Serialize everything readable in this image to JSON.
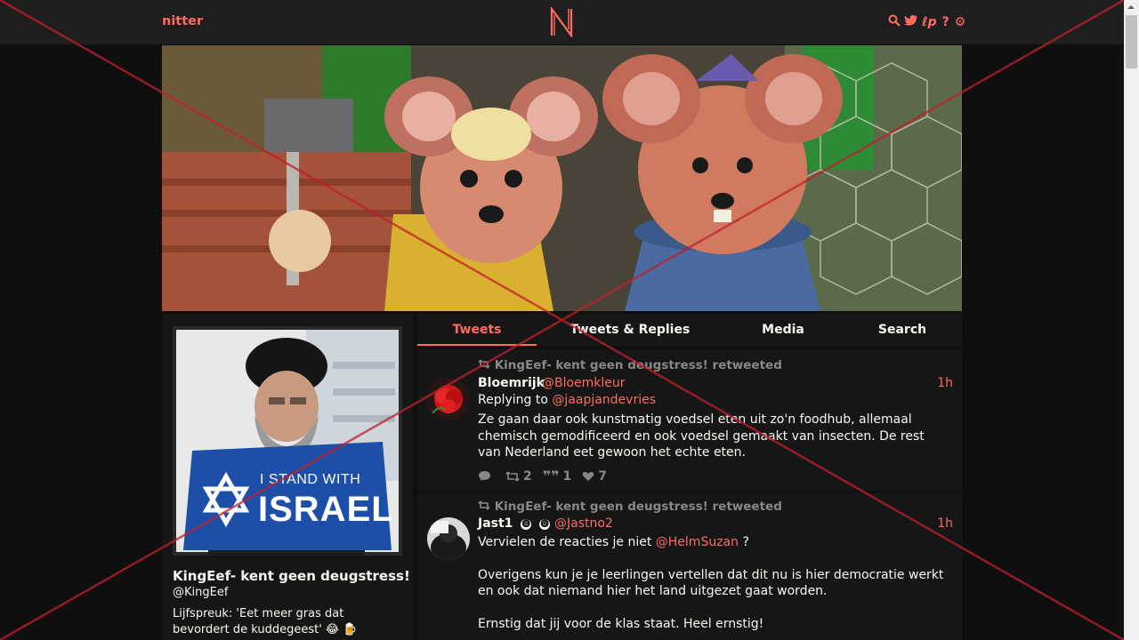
{
  "navbar": {
    "site_name": "nitter",
    "logo_letter": "N",
    "icons": [
      "search-icon",
      "bird-icon",
      "rss-icon",
      "help-icon",
      "gear-icon"
    ],
    "accent_color": "#ff6c60"
  },
  "profile": {
    "fullname": "KingEef- kent geen deugstress!",
    "username": "@KingEef",
    "bio": "Lijfspreuk: 'Eet meer gras dat bevordert de kuddegeest' 😂 🍺",
    "avatar_sign_line1": "I STAND WITH",
    "avatar_sign_line2": "ISRAEL"
  },
  "tabs": [
    {
      "label": "Tweets",
      "active": true
    },
    {
      "label": "Tweets & Replies",
      "active": false
    },
    {
      "label": "Media",
      "active": false
    },
    {
      "label": "Search",
      "active": false
    }
  ],
  "tweets": [
    {
      "retweet_header": "KingEef- kent geen deugstress! retweeted",
      "fullname": "Bloemrijk",
      "username": "@Bloemkleur",
      "date": "1h",
      "replying_label": "Replying to",
      "replying_to": "@jaapjandevries",
      "body": "Ze gaan daar ook kunstmatig voedsel eten uit zo'n foodhub, allemaal chemisch gemodificeerd en ook voedsel gemaakt van insecten. De rest van Nederland eet gewoon het echte eten.",
      "stats": {
        "comments": "",
        "retweets": "2",
        "quotes": "1",
        "likes": "7"
      }
    },
    {
      "retweet_header": "KingEef- kent geen deugstress! retweeted",
      "fullname": "Jast1",
      "badges": [
        "🅑",
        "🅑"
      ],
      "username": "@Jastno2",
      "date": "1h",
      "body_line1_pre": "Vervielen de reacties je niet",
      "body_line1_mention": "@HelmSuzan",
      "body_line1_post": "?",
      "body_para2": "Overigens kun je je leerlingen vertellen dat dit nu is hier democratie werkt en ook dat niemand hier het land uitgezet gaat worden.",
      "body_para3": "Ernstig dat jij voor de klas staat. Heel ernstig!"
    }
  ]
}
